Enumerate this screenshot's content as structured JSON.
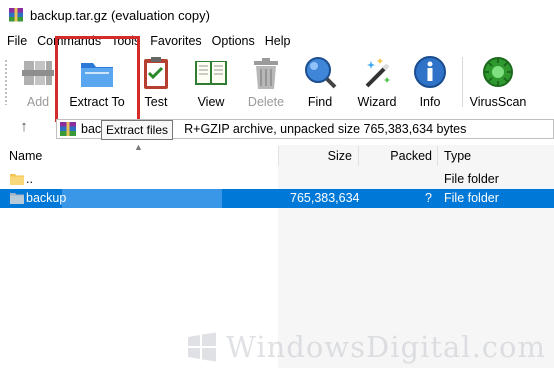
{
  "window": {
    "title": "backup.tar.gz (evaluation copy)",
    "app_icon": "winrar-archive-icon"
  },
  "menubar": {
    "items": [
      "File",
      "Commands",
      "Tools",
      "Favorites",
      "Options",
      "Help"
    ]
  },
  "toolbar": {
    "buttons": [
      {
        "label": "Add",
        "icon": "add-archive-icon",
        "enabled": false
      },
      {
        "label": "Extract To",
        "icon": "folder-extract-icon",
        "enabled": true,
        "highlighted": true
      },
      {
        "label": "Test",
        "icon": "test-clipboard-icon",
        "enabled": true
      },
      {
        "label": "View",
        "icon": "book-view-icon",
        "enabled": true
      },
      {
        "label": "Delete",
        "icon": "trash-can-icon",
        "enabled": false
      },
      {
        "label": "Find",
        "icon": "magnifier-icon",
        "enabled": true
      },
      {
        "label": "Wizard",
        "icon": "magic-wand-icon",
        "enabled": true
      },
      {
        "label": "Info",
        "icon": "info-icon",
        "enabled": true
      },
      {
        "label": "VirusScan",
        "icon": "virus-scan-icon",
        "enabled": true
      }
    ],
    "highlight_color": "#d42a2a"
  },
  "addressbar": {
    "prefix": "bac",
    "suffix": "R+GZIP archive, unpacked size 765,383,634 bytes"
  },
  "tooltip": {
    "text": "Extract files"
  },
  "filelist": {
    "columns": {
      "name": "Name",
      "size": "Size",
      "packed": "Packed",
      "type": "Type"
    },
    "rows": [
      {
        "name": "..",
        "size": "",
        "packed": "",
        "type": "File folder",
        "selected": false
      },
      {
        "name": "backup",
        "size": "765,383,634",
        "packed": "?",
        "type": "File folder",
        "selected": true
      }
    ],
    "selection_color": "#0078d7"
  },
  "watermark": {
    "text": "WindowsDigital.com"
  }
}
